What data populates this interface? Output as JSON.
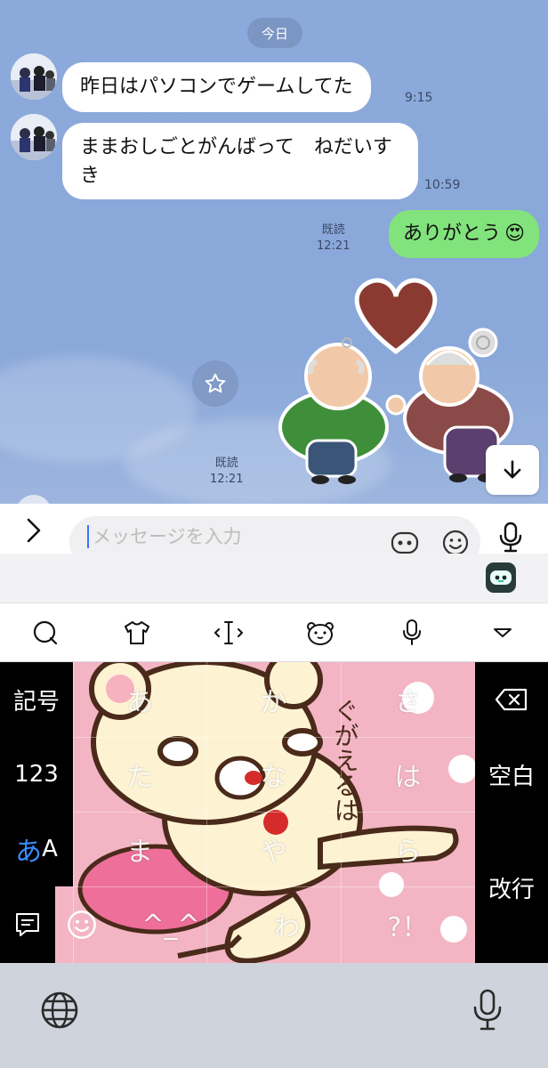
{
  "chat": {
    "date_label": "今日",
    "messages": [
      {
        "side": "in",
        "text": "昨日はパソコンでゲームしてた",
        "time": "9:15"
      },
      {
        "side": "in",
        "text": "ままおしごとがんばって　ねだいすき",
        "time": "10:59"
      },
      {
        "side": "out",
        "text": "ありがとう",
        "emoji": "😍",
        "read": "既読",
        "time": "12:21"
      },
      {
        "side": "out",
        "type": "sticker",
        "read": "既読",
        "time": "12:21"
      }
    ]
  },
  "input": {
    "placeholder": "メッセージを入力"
  },
  "keyboard": {
    "left_keys": [
      "記号",
      "123",
      "あA"
    ],
    "a_letter": "あ",
    "a_suffix": "A",
    "kana_keys": [
      "あ",
      "か",
      "さ",
      "た",
      "な",
      "は",
      "ま",
      "や",
      "ら",
      "^_^",
      "わ",
      "?！"
    ],
    "right_keys": {
      "space": "空白",
      "enter": "改行"
    },
    "accent_color": "#3b8dff"
  },
  "sticker_text": "ぐがえるは"
}
